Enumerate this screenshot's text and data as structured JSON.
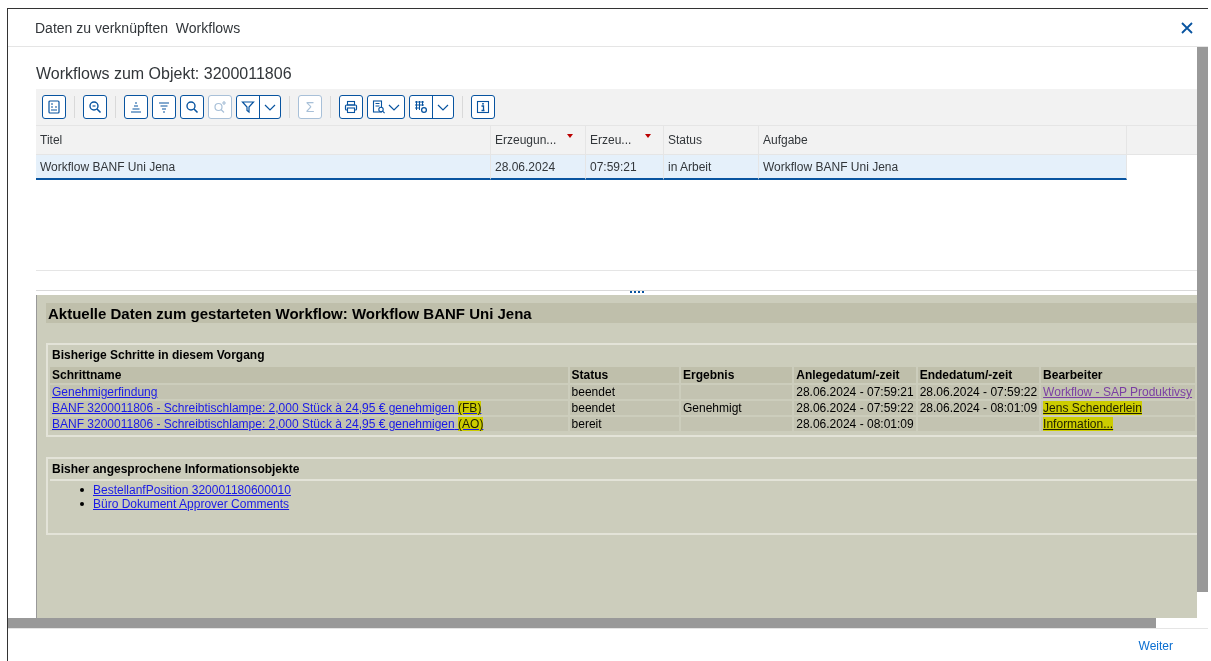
{
  "dialog": {
    "title": "Daten zu verknüpften  Workflows",
    "footer_button": "Weiter"
  },
  "section_title": "Workflows zum Objekt: 3200011806",
  "toolbar": [
    {
      "kind": "details",
      "disabled": false
    },
    {
      "kind": "zoom",
      "disabled": false,
      "group_start": true
    },
    {
      "kind": "sort-asc",
      "disabled": false,
      "group_start": true
    },
    {
      "kind": "sort-desc",
      "disabled": false
    },
    {
      "kind": "find",
      "disabled": false
    },
    {
      "kind": "find-next",
      "disabled": true
    },
    {
      "kind": "filter",
      "disabled": false,
      "menu": true,
      "split": true
    },
    {
      "kind": "sum",
      "label": "Σ",
      "disabled": true,
      "group_start": true
    },
    {
      "kind": "print",
      "disabled": false,
      "group_start": true
    },
    {
      "kind": "view",
      "disabled": false,
      "menu": true,
      "split": false
    },
    {
      "kind": "layout",
      "disabled": false,
      "menu": true,
      "split": true
    },
    {
      "kind": "info",
      "disabled": false,
      "group_start": true
    }
  ],
  "grid": {
    "columns": [
      {
        "label": "Titel",
        "sort_marker": false
      },
      {
        "label": "Erzeugun...",
        "sort_marker": true
      },
      {
        "label": "Erzeu...",
        "sort_marker": true
      },
      {
        "label": "Status",
        "sort_marker": false
      },
      {
        "label": "Aufgabe",
        "sort_marker": false
      }
    ],
    "rows": [
      {
        "cells": [
          "Workflow BANF Uni Jena",
          "28.06.2024",
          "07:59:21",
          "in Arbeit",
          "Workflow BANF Uni Jena"
        ],
        "selected": true
      }
    ]
  },
  "panel": {
    "title": "Aktuelle Daten zum gestarteten Workflow: Workflow BANF Uni Jena",
    "steps": {
      "title": "Bisherige Schritte in diesem Vorgang",
      "columns": [
        "Schrittname",
        "Status",
        "Ergebnis",
        "Anlegedatum/-zeit",
        "Endedatum/-zeit",
        "Bearbeiter"
      ],
      "rows": [
        {
          "step": "Genehmigerfindung",
          "status": "beendet",
          "created": "28.06.2024 - 07:59:21",
          "ended": "28.06.2024 - 07:59:22",
          "agent": "Workflow - SAP Produktivsy",
          "agent_visited": true,
          "agent_highlighted": false
        },
        {
          "step": "BANF 3200011806 - Schreibtischlampe: 2,000 Stück à 24,95 € genehmigen",
          "step_tag": "(FB)",
          "status": "beendet",
          "result": "Genehmigt",
          "created": "28.06.2024 - 07:59:22",
          "ended": "28.06.2024 - 08:01:09",
          "agent": "Jens Schenderlein",
          "agent_visited": false,
          "agent_highlighted": true
        },
        {
          "step": "BANF 3200011806 - Schreibtischlampe: 2,000 Stück à 24,95 € genehmigen",
          "step_tag": "(AO)",
          "status": "bereit",
          "created": "28.06.2024 - 08:01:09",
          "agent": "Information...",
          "agent_visited": false,
          "agent_highlighted": true
        }
      ]
    },
    "info_objects": {
      "title": "Bisher angesprochene Informationsobjekte",
      "items": [
        "BestellanfPosition 320001180600010",
        "Büro Dokument Approver Comments"
      ]
    }
  }
}
